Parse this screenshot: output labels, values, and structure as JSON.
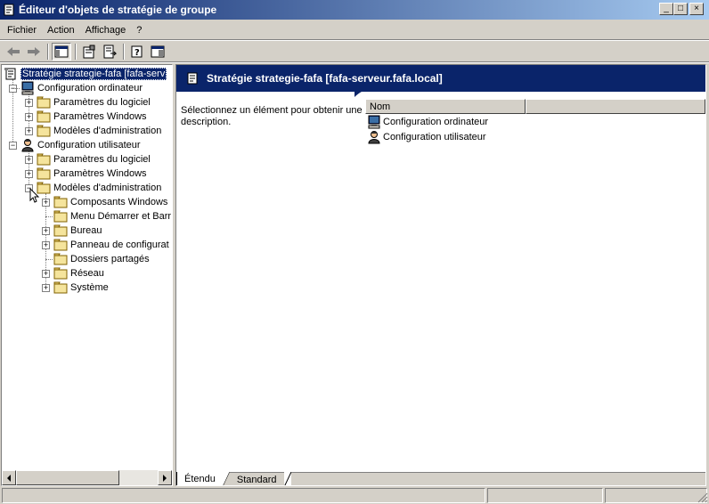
{
  "window": {
    "title": "Éditeur d'objets de stratégie de groupe",
    "minimize_label": "_",
    "maximize_label": "□",
    "close_label": "×"
  },
  "menu": {
    "items": [
      "Fichier",
      "Action",
      "Affichage",
      "?"
    ]
  },
  "toolbar": {
    "buttons": [
      "back-arrow-icon",
      "forward-arrow-icon",
      "show-hide-tree-icon",
      "properties-icon",
      "export-list-icon",
      "help-icon",
      "console-tree-icon"
    ]
  },
  "tree": {
    "root": "Stratégie strategie-fafa [fafa-serv",
    "computer_config": "Configuration ordinateur",
    "computer_children": [
      "Paramètres du logiciel",
      "Paramètres Windows",
      "Modèles d'administration"
    ],
    "user_config": "Configuration utilisateur",
    "user_children": [
      "Paramètres du logiciel",
      "Paramètres Windows",
      "Modèles d'administration"
    ],
    "admin_templates_children": [
      "Composants Windows",
      "Menu Démarrer et Barr",
      "Bureau",
      "Panneau de configurat",
      "Dossiers partagés",
      "Réseau",
      "Système"
    ]
  },
  "right": {
    "header_title": "Stratégie strategie-fafa [fafa-serveur.fafa.local]",
    "description": "Sélectionnez un élément pour obtenir une description.",
    "column_name": "Nom",
    "items": [
      "Configuration ordinateur",
      "Configuration utilisateur"
    ]
  },
  "tabs": {
    "extended": "Étendu",
    "standard": "Standard"
  },
  "colors": {
    "title_gradient_start": "#0a246a",
    "title_gradient_end": "#a6caf0",
    "face": "#d4d0c8",
    "selection": "#0a246a"
  }
}
